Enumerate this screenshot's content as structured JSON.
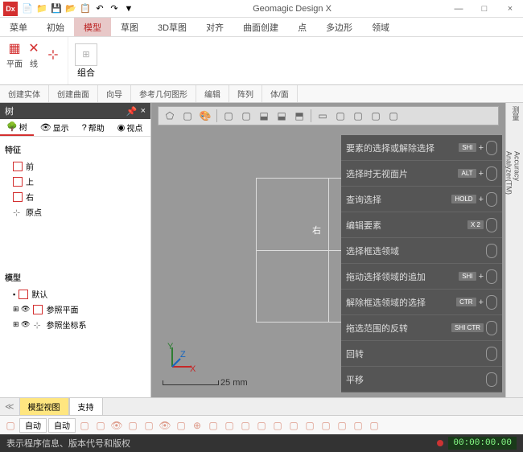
{
  "title": "Geomagic Design X",
  "window": {
    "min": "—",
    "max": "□",
    "close": "×"
  },
  "qat": [
    "📄",
    "📁",
    "💾",
    "📂",
    "📋",
    "↶",
    "↷",
    "▼"
  ],
  "menu": [
    {
      "label": "菜单",
      "active": false
    },
    {
      "label": "初始",
      "active": false
    },
    {
      "label": "模型",
      "active": true
    },
    {
      "label": "草图",
      "active": false
    },
    {
      "label": "3D草图",
      "active": false
    },
    {
      "label": "对齐",
      "active": false
    },
    {
      "label": "曲面创建",
      "active": false
    },
    {
      "label": "点",
      "active": false
    },
    {
      "label": "多边形",
      "active": false
    },
    {
      "label": "领域",
      "active": false
    }
  ],
  "ribbon": {
    "items": [
      {
        "sym": "▦",
        "label": "平面"
      },
      {
        "sym": "✕",
        "label": "线"
      },
      {
        "sym": "⊹",
        "label": ""
      }
    ],
    "combine": "组合"
  },
  "ribbon2": [
    "创建实体",
    "创建曲面",
    "向导",
    "参考几何图形",
    "编辑",
    "阵列",
    "体/面"
  ],
  "leftpanel": {
    "hdr": "树",
    "pin": "📌",
    "close": "×",
    "tabs": [
      {
        "ico": "🌳",
        "label": "树",
        "active": true
      },
      {
        "ico": "👁",
        "label": "显示"
      },
      {
        "ico": "?",
        "label": "帮助"
      },
      {
        "ico": "◉",
        "label": "视点"
      }
    ],
    "sec1": "特征",
    "items1": [
      {
        "label": "前"
      },
      {
        "label": "上"
      },
      {
        "label": "右"
      },
      {
        "label": "原点",
        "axis": true
      }
    ],
    "sec2": "模型",
    "items2": [
      {
        "pre": "▪",
        "label": "默认"
      },
      {
        "pre": "⊞ 👁",
        "label": "参照平面"
      },
      {
        "pre": "⊞ 👁",
        "label": "参照坐标系",
        "axis": true
      }
    ]
  },
  "viewport": {
    "right_label": "右",
    "scale": "25 mm",
    "toolbar": [
      "⬠",
      "▢",
      "🎨",
      "|",
      "▢",
      "▢",
      "⬓",
      "⬓",
      "⬒",
      "|",
      "▭",
      "▢",
      "▢",
      "▢",
      "▢"
    ]
  },
  "hints": [
    {
      "text": "要素的选择或解除选择",
      "key": "SHI",
      "plus": "+"
    },
    {
      "text": "选择时无视面片",
      "key": "ALT",
      "plus": "+"
    },
    {
      "text": "查询选择",
      "key": "HOLD",
      "plus": "+"
    },
    {
      "text": "编辑要素",
      "key": "X 2",
      "plus": ""
    },
    {
      "text": "选择框选领域",
      "key": "",
      "plus": ""
    },
    {
      "text": "拖动选择领域的追加",
      "key": "SHI",
      "plus": "+"
    },
    {
      "text": "解除框选领域的选择",
      "key": "CTR",
      "plus": "+"
    },
    {
      "text": "拖选范围的反转",
      "key": "SHI CTR",
      "plus": ""
    },
    {
      "text": "回转",
      "key": "",
      "plus": ""
    },
    {
      "text": "平移",
      "key": "",
      "plus": ""
    }
  ],
  "rightbar": [
    {
      "label": "测量"
    },
    {
      "label": "Accuracy Analyzer(TM)"
    }
  ],
  "bottom_tabs": [
    {
      "label": "模型视图",
      "active": true
    },
    {
      "label": "支持",
      "active": false
    }
  ],
  "iconbar": {
    "left": [
      "▢"
    ],
    "sel1": "自动",
    "sel2": "自动",
    "icons": [
      "▢",
      "▢",
      "👁",
      "▢",
      "▢",
      "👁",
      "▢",
      "⊕",
      "▢",
      "▢",
      "▢",
      "▢",
      "▢",
      "▢",
      "▢",
      "▢",
      "▢",
      "▢",
      "▢"
    ]
  },
  "status": {
    "msg": "表示程序信息、版本代号和版权",
    "time": "00:00:00.00"
  }
}
